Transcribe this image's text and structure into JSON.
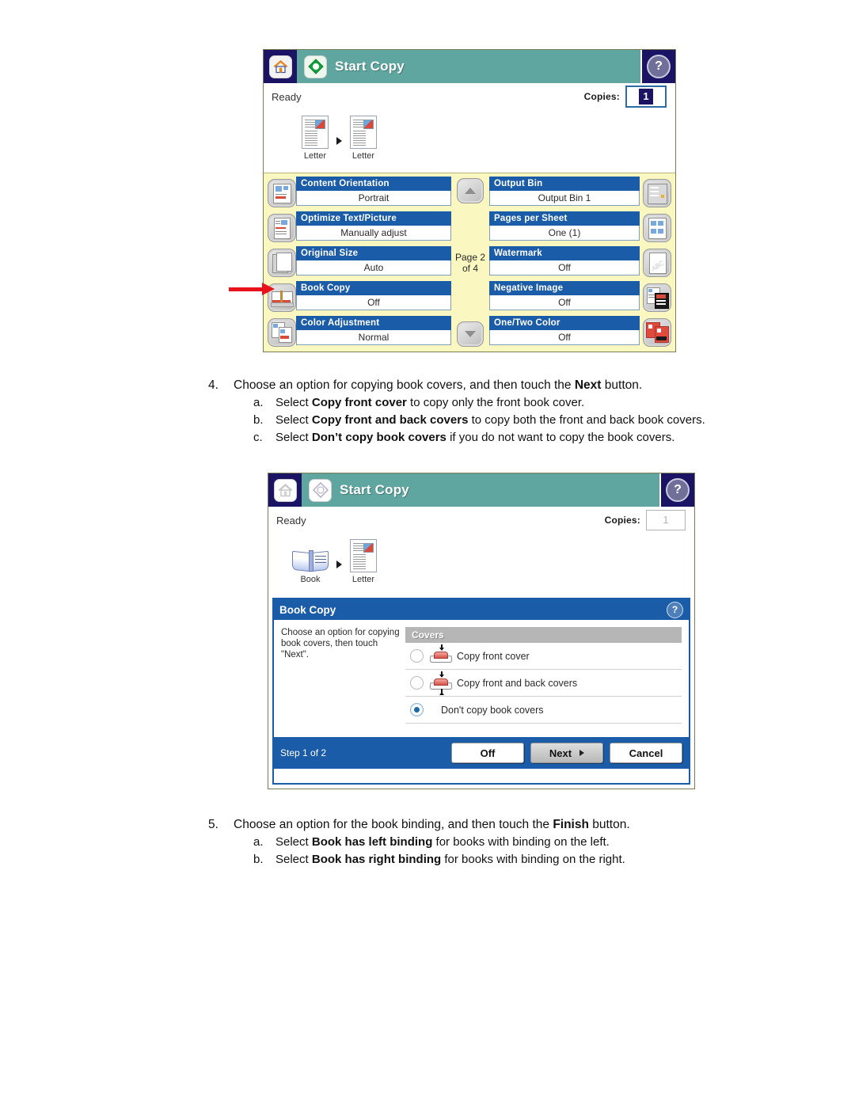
{
  "screen_one": {
    "header": {
      "home_icon": "home-icon",
      "start_icon": "start-copy-icon",
      "title": "Start Copy",
      "help_icon": "help-icon",
      "help_glyph": "?"
    },
    "status": {
      "ready": "Ready",
      "copies_label": "Copies:",
      "copies_value": "1"
    },
    "thumbnails": [
      {
        "caption": "Letter",
        "icon": "document-icon"
      },
      {
        "caption": "Letter",
        "icon": "document-icon"
      }
    ],
    "pager": {
      "line1": "Page 2",
      "line2": "of 4"
    },
    "scroll_up": "scroll-up-icon",
    "scroll_down": "scroll-down-icon",
    "options_left": [
      {
        "title": "Content Orientation",
        "value": "Portrait",
        "icon": "content-orientation-icon"
      },
      {
        "title": "Optimize Text/Picture",
        "value": "Manually adjust",
        "icon": "optimize-text-picture-icon"
      },
      {
        "title": "Original Size",
        "value": "Auto",
        "icon": "original-size-icon"
      },
      {
        "title": "Book Copy",
        "value": "Off",
        "icon": "book-copy-icon"
      },
      {
        "title": "Color Adjustment",
        "value": "Normal",
        "icon": "color-adjustment-icon"
      }
    ],
    "options_right": [
      {
        "title": "Output Bin",
        "value": "Output Bin 1",
        "icon": "output-bin-icon"
      },
      {
        "title": "Pages per Sheet",
        "value": "One (1)",
        "icon": "pages-per-sheet-icon"
      },
      {
        "title": "Watermark",
        "value": "Off",
        "icon": "watermark-icon"
      },
      {
        "title": "Negative Image",
        "value": "Off",
        "icon": "negative-image-icon"
      },
      {
        "title": "One/Two Color",
        "value": "Off",
        "icon": "one-two-color-icon"
      }
    ]
  },
  "step4": {
    "number": "4.",
    "text_pre": "Choose an option for copying book covers, and then touch the ",
    "text_bold": "Next",
    "text_post": " button.",
    "items": [
      {
        "marker": "a.",
        "pre": "Select ",
        "bold": "Copy front cover",
        "post": " to copy only the front book cover."
      },
      {
        "marker": "b.",
        "pre": "Select ",
        "bold": "Copy front and back covers",
        "post": " to copy both the front and back book covers."
      },
      {
        "marker": "c.",
        "pre": "Select ",
        "bold": "Don’t copy book covers",
        "post": " if you do not want to copy the book covers."
      }
    ]
  },
  "screen_two": {
    "header": {
      "home_icon": "home-icon",
      "start_icon": "start-copy-icon",
      "title": "Start Copy",
      "help_icon": "help-icon",
      "help_glyph": "?"
    },
    "status": {
      "ready": "Ready",
      "copies_label": "Copies:",
      "copies_value": "1"
    },
    "thumbnails": [
      {
        "caption": "Book",
        "icon": "book-icon"
      },
      {
        "caption": "Letter",
        "icon": "document-icon"
      }
    ],
    "dialog": {
      "title": "Book Copy",
      "help_glyph": "?",
      "description": "Choose an option for copying book covers, then touch \"Next\".",
      "group_header": "Covers",
      "options": [
        {
          "label": "Copy front cover",
          "selected": false,
          "icon": "front-cover-icon"
        },
        {
          "label": "Copy front and back covers",
          "selected": false,
          "icon": "front-back-cover-icon"
        },
        {
          "label": "Don't copy book covers",
          "selected": true,
          "icon": "none"
        }
      ],
      "footer": {
        "step_label": "Step 1 of 2",
        "off_label": "Off",
        "next_label": "Next",
        "cancel_label": "Cancel"
      }
    }
  },
  "step5": {
    "number": "5.",
    "text_pre": "Choose an option for the book binding, and then touch the ",
    "text_bold": "Finish",
    "text_post": " button.",
    "items": [
      {
        "marker": "a.",
        "pre": "Select ",
        "bold": "Book has left binding",
        "post": " for books with binding on the left."
      },
      {
        "marker": "b.",
        "pre": "Select ",
        "bold": "Book has right binding",
        "post": " for books with binding on the right."
      }
    ]
  },
  "colors": {
    "teal_header": "#5fa6a0",
    "navy_square": "#1b1464",
    "blue_label": "#1b5ca8",
    "yellow_panel": "#fbf7c0",
    "annotation_red": "#e8131a",
    "gray_group": "#b6b6b6"
  }
}
